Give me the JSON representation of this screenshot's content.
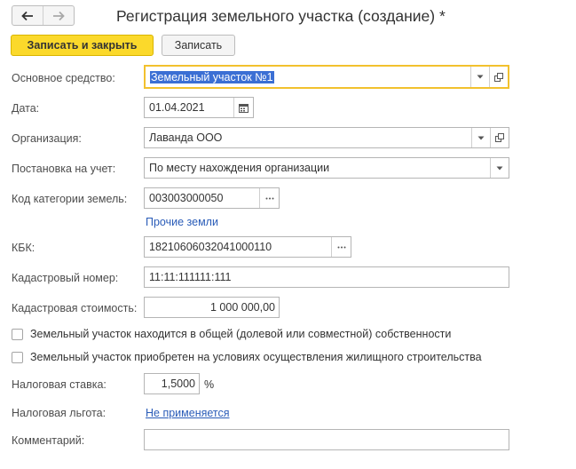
{
  "window": {
    "title": "Регистрация земельного участка (создание) *"
  },
  "nav": {
    "back_icon": "arrow-left-icon",
    "forward_icon": "arrow-right-icon"
  },
  "toolbar": {
    "save_close_label": "Записать и закрыть",
    "save_label": "Записать"
  },
  "form": {
    "asset": {
      "label": "Основное средство:",
      "value": "Земельный участок №1"
    },
    "date": {
      "label": "Дата:",
      "value": "01.04.2021"
    },
    "organization": {
      "label": "Организация:",
      "value": "Лаванда ООО"
    },
    "registration": {
      "label": "Постановка на учет:",
      "value": "По месту нахождения организации"
    },
    "land_category": {
      "label": "Код категории земель:",
      "value": "003003000050",
      "hint": "Прочие земли"
    },
    "kbk": {
      "label": "КБК:",
      "value": "18210606032041000110"
    },
    "cadastral_number": {
      "label": "Кадастровый номер:",
      "value": "11:11:111111:111"
    },
    "cadastral_value": {
      "label": "Кадастровая стоимость:",
      "value": "1 000 000,00"
    },
    "shared_ownership": {
      "label": "Земельный участок находится в общей (долевой или совместной) собственности",
      "checked": false
    },
    "housing_construction": {
      "label": "Земельный участок приобретен на условиях осуществления жилищного строительства",
      "checked": false
    },
    "tax_rate": {
      "label": "Налоговая ставка:",
      "value": "1,5000",
      "unit": "%"
    },
    "tax_benefit": {
      "label": "Налоговая льгота:",
      "value": "Не применяется"
    },
    "comment": {
      "label": "Комментарий:",
      "value": ""
    }
  },
  "colors": {
    "primary_button": "#fbd92b",
    "focus_border": "#f2c12e",
    "link": "#2a5cb8",
    "selection": "#3b6fd4"
  }
}
